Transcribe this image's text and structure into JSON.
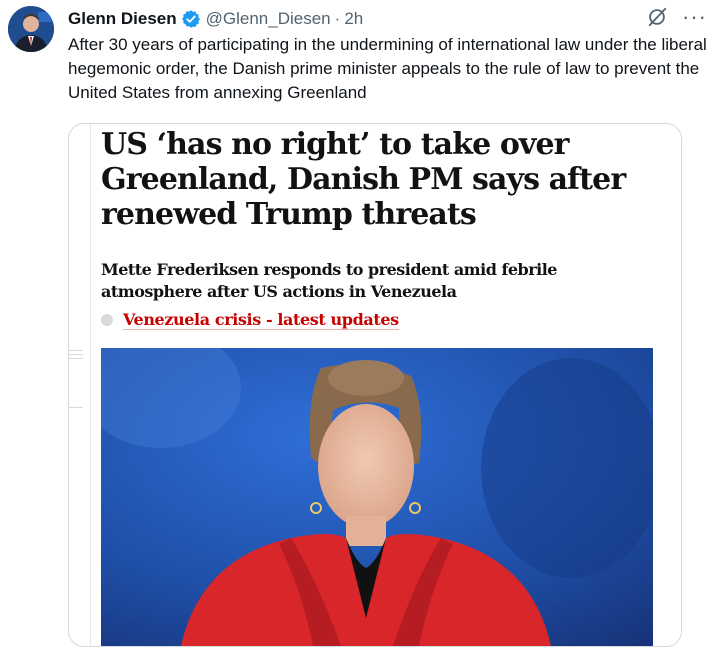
{
  "author": {
    "name": "Glenn Diesen",
    "handle": "@Glenn_Diesen",
    "separator": "·",
    "time": "2h"
  },
  "icons": {
    "verified": "verified-badge-icon",
    "grok": "grok-icon",
    "more": "more-options-icon"
  },
  "tweet": {
    "text": "After 30 years of participating in the undermining of international law under the liberal hegemonic order, the Danish prime minister appeals to the rule of law to prevent the United States from annexing Greenland"
  },
  "article": {
    "headline": "US ‘has no right’ to take over Greenland, Danish PM says after renewed Trump threats",
    "standfirst": "Mette Frederiksen responds to president amid febrile atmosphere after US actions in Venezuela",
    "live_link": "Venezuela crisis - latest updates"
  },
  "colors": {
    "verified": "#1d9bf0",
    "link_red": "#c70000",
    "photo_background": "#1f4fa8",
    "coat": "#d8262a"
  },
  "more_label": "···"
}
